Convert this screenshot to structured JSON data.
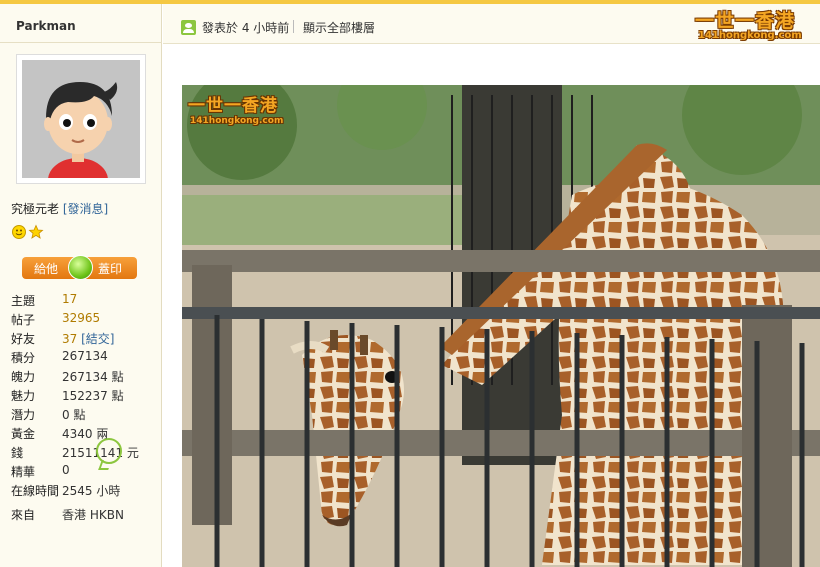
{
  "user": {
    "username": "Parkman",
    "rank": "究極元老",
    "send_message": "[發消息]",
    "give_button": {
      "left": "給他",
      "right": "蓋印"
    }
  },
  "stats": [
    {
      "key": "主題",
      "value": "17"
    },
    {
      "key": "帖子",
      "value": "32965"
    },
    {
      "key": "好友",
      "value": "37",
      "extra": "[結交]"
    },
    {
      "key": "積分",
      "value": "267134"
    },
    {
      "key": "魄力",
      "value": "267134 點"
    },
    {
      "key": "魅力",
      "value": "152237 點"
    },
    {
      "key": "潛力",
      "value": "0 點"
    },
    {
      "key": "黃金",
      "value": "4340 兩"
    },
    {
      "key": "錢",
      "value": "21511141 元"
    },
    {
      "key": "精華",
      "value": "0"
    },
    {
      "key": "在線時間",
      "value": "2545 小時"
    },
    {
      "key": "來自",
      "value": "香港 HKBN"
    }
  ],
  "post": {
    "time": "發表於 4 小時前",
    "show_all": "顯示全部樓層"
  },
  "site_logo": {
    "title": "一世一香港",
    "domain": "141hongkong.com"
  },
  "photo_watermark": {
    "title": "一世一香港",
    "domain": "141hongkong.com"
  },
  "icons": {
    "post-author-icon": "user-icon",
    "rank-badges": [
      "smiley-icon",
      "star-icon"
    ],
    "money-annotation": "speech-bubble-icon"
  },
  "colors": {
    "accent": "#f5c842",
    "sidebar_bg": "#fdfbf0",
    "link": "#336699",
    "count_link": "#b07b00",
    "button": "#e37710"
  }
}
